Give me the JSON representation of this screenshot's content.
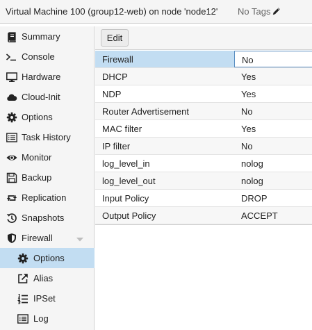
{
  "header": {
    "title": "Virtual Machine 100 (group12-web) on node 'node12'",
    "tags_label": "No Tags"
  },
  "sidebar": {
    "items": [
      {
        "label": "Summary",
        "icon": "book-icon"
      },
      {
        "label": "Console",
        "icon": "terminal-icon"
      },
      {
        "label": "Hardware",
        "icon": "monitor-icon"
      },
      {
        "label": "Cloud-Init",
        "icon": "cloud-icon"
      },
      {
        "label": "Options",
        "icon": "gear-icon"
      },
      {
        "label": "Task History",
        "icon": "list-icon"
      },
      {
        "label": "Monitor",
        "icon": "eye-icon"
      },
      {
        "label": "Backup",
        "icon": "save-icon"
      },
      {
        "label": "Replication",
        "icon": "retweet-icon"
      },
      {
        "label": "Snapshots",
        "icon": "history-icon"
      },
      {
        "label": "Firewall",
        "icon": "shield-icon"
      },
      {
        "label": "Options",
        "icon": "gear-icon"
      },
      {
        "label": "Alias",
        "icon": "external-link-icon"
      },
      {
        "label": "IPSet",
        "icon": "list-ol-icon"
      },
      {
        "label": "Log",
        "icon": "list-icon"
      }
    ]
  },
  "toolbar": {
    "edit_label": "Edit"
  },
  "firewall_options": {
    "rows": [
      {
        "name": "Firewall",
        "value": "No"
      },
      {
        "name": "DHCP",
        "value": "Yes"
      },
      {
        "name": "NDP",
        "value": "Yes"
      },
      {
        "name": "Router Advertisement",
        "value": "No"
      },
      {
        "name": "MAC filter",
        "value": "Yes"
      },
      {
        "name": "IP filter",
        "value": "No"
      },
      {
        "name": "log_level_in",
        "value": "nolog"
      },
      {
        "name": "log_level_out",
        "value": "nolog"
      },
      {
        "name": "Input Policy",
        "value": "DROP"
      },
      {
        "name": "Output Policy",
        "value": "ACCEPT"
      }
    ]
  },
  "colors": {
    "selection": "#c2ddf2",
    "panel": "#f5f5f5",
    "border": "#cfcfcf"
  }
}
